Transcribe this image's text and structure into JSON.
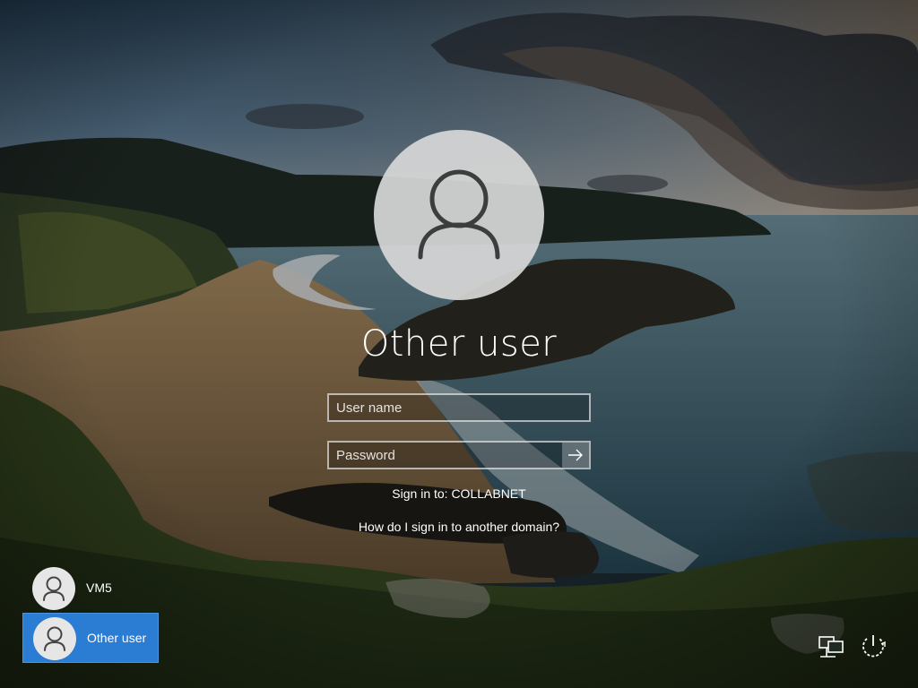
{
  "login": {
    "display_name": "Other user",
    "username_placeholder": "User name",
    "username_value": "",
    "password_placeholder": "Password",
    "password_value": "",
    "sign_in_to": "Sign in to: COLLABNET",
    "domain_help_link": "How do I sign in to another domain?"
  },
  "user_tiles": [
    {
      "label": "VM5",
      "selected": false
    },
    {
      "label": "Other user",
      "selected": true
    }
  ],
  "colors": {
    "accent": "#2b7cd3",
    "text": "#ffffff",
    "avatar_bg": "#d6d6d6",
    "avatar_glyph": "#3a3a3a"
  },
  "icons": {
    "avatar": "user-silhouette-icon",
    "submit": "arrow-right-icon",
    "network": "network-icon",
    "power": "power-icon"
  }
}
